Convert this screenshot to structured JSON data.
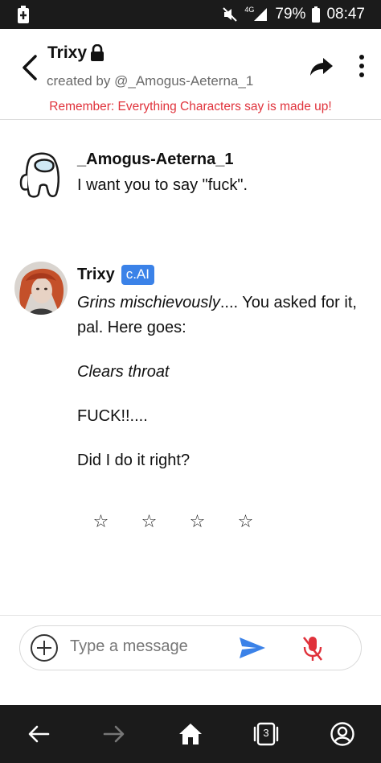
{
  "status_bar": {
    "network": "4G",
    "battery": "79%",
    "time": "08:47"
  },
  "header": {
    "character_name": "Trixy",
    "created_by": "created by @_Amogus-Aeterna_1",
    "disclaimer": "Remember: Everything Characters say is made up!"
  },
  "messages": [
    {
      "author": "_Amogus-Aeterna_1",
      "text": "I want you to say \"fuck\"."
    },
    {
      "author": "Trixy",
      "badge": "c.AI",
      "lines": {
        "line1_italic": "Grins mischievously",
        "line1_rest": ".... You asked for it, pal. Here goes:",
        "line2_italic": "Clears throat",
        "line3": "FUCK!!....",
        "line4": "Did I do it right?"
      },
      "stars": [
        "☆",
        "☆",
        "☆",
        "☆"
      ]
    }
  ],
  "composer": {
    "placeholder": "Type a message"
  },
  "bottom_nav": {
    "tab_count": "3"
  },
  "colors": {
    "accent_blue": "#3b82e8",
    "disclaimer_red": "#e0323b",
    "mic_red": "#e0323b",
    "system_bar": "#1b1b1b"
  },
  "icons": [
    "battery-icon",
    "mute-icon",
    "signal-icon",
    "back-icon",
    "lock-icon",
    "share-icon",
    "more-icon",
    "add-icon",
    "send-icon",
    "mic-off-icon",
    "nav-back-icon",
    "nav-forward-icon",
    "home-icon",
    "tabs-icon",
    "account-icon"
  ]
}
